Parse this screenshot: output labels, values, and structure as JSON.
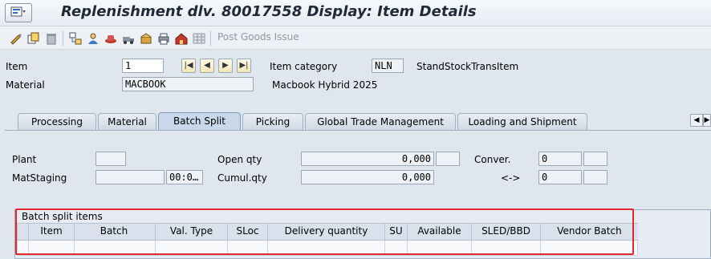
{
  "window": {
    "title": "Replenishment dlv. 80017558 Display: Item Details"
  },
  "toolbar": {
    "icons": [
      "display-change-icon",
      "copy-icon",
      "delete-icon",
      "document-flow-icon",
      "partner-icon",
      "hat-icon",
      "shipment-icon",
      "picking-icon",
      "print-icon",
      "warehouse-icon",
      "grid-icon"
    ],
    "post_goods_issue_label": "Post Goods Issue"
  },
  "header": {
    "item_label": "Item",
    "item_value": "1",
    "item_category_label": "Item category",
    "item_category_value": "NLN",
    "item_category_desc": "StandStockTransItem",
    "material_label": "Material",
    "material_value": "MACBOOK",
    "material_desc": "Macbook Hybrid 2025",
    "nav_buttons": [
      "|◀",
      "◀",
      "▶",
      "▶|"
    ]
  },
  "tabs": [
    {
      "label": "Processing",
      "active": false
    },
    {
      "label": "Material",
      "active": false
    },
    {
      "label": "Batch Split",
      "active": true
    },
    {
      "label": "Picking",
      "active": false
    },
    {
      "label": "Global Trade Management",
      "active": false
    },
    {
      "label": "Loading and Shipment",
      "active": false
    }
  ],
  "batch_split": {
    "plant_label": "Plant",
    "plant_value": "",
    "matstaging_label": "MatStaging",
    "matstaging_value": "",
    "matstaging_time": "00:0…",
    "open_qty_label": "Open qty",
    "open_qty_value": "0,000",
    "open_qty_unit": "",
    "cumul_qty_label": "Cumul.qty",
    "cumul_qty_value": "0,000",
    "conver_label": "Conver.",
    "conver_value_1": "0",
    "conver_unit_1": "",
    "arrow_label": "<->",
    "conver_value_2": "0",
    "conver_unit_2": ""
  },
  "batch_items": {
    "title": "Batch split items",
    "columns": [
      "Item",
      "Batch",
      "Val. Type",
      "SLoc",
      "Delivery quantity",
      "SU",
      "Available",
      "SLED/BBD",
      "Vendor Batch"
    ],
    "rows": []
  },
  "colors": {
    "highlight": "#e0282e",
    "background": "#dfe6ed"
  }
}
